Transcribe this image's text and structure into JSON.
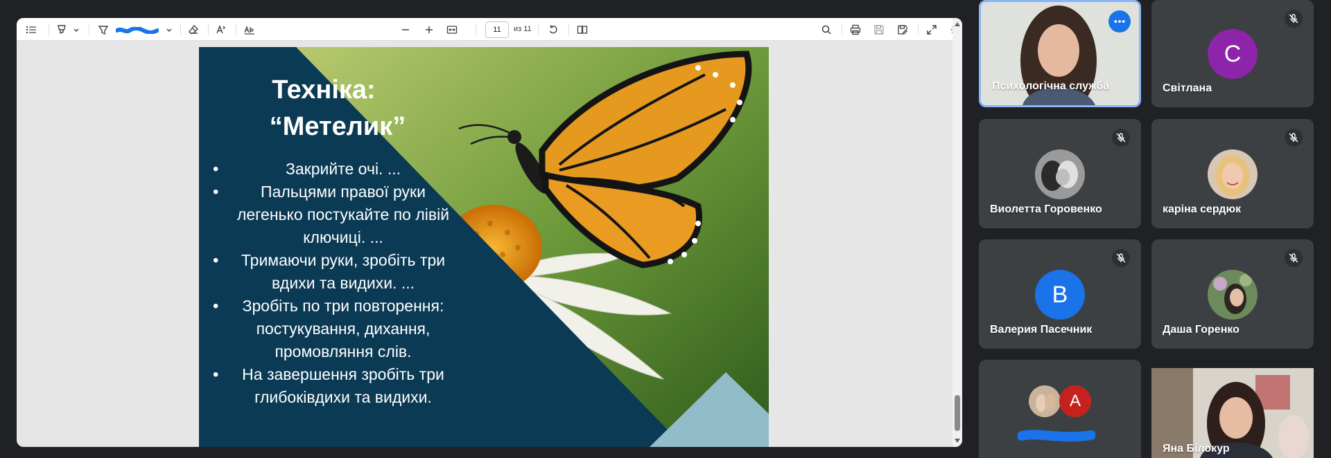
{
  "viewer": {
    "page_current": "11",
    "page_of": "из 11",
    "slide": {
      "title_line1": "Техніка:",
      "title_line2": "“Метелик”",
      "bullets": [
        "Закрийте очі. ...",
        "Пальцями правої руки легенько постукайте по лівій ключиці. ...",
        "Тримаючи руки, зробіть три вдихи та видихи. ...",
        "Зробіть по три повторення: постукування, дихання, промовляння слів.",
        "На завершення зробіть три глибоківдихи та видихи."
      ]
    },
    "icons": [
      "contents-icon",
      "highlighter-icon",
      "chevron-down-icon",
      "pen-icon",
      "color-scribble",
      "chevron-down-icon",
      "eraser-icon",
      "text-size-icon",
      "text-ab-icon",
      "zoom-out-icon",
      "zoom-in-icon",
      "fit-page-icon",
      "rotate-icon",
      "two-page-icon",
      "search-icon",
      "print-icon",
      "save-icon",
      "save-as-icon",
      "fullscreen-icon",
      "settings-icon"
    ]
  },
  "participants": [
    {
      "name": "Психологічна служба",
      "type": "video",
      "active_speaker": true
    },
    {
      "name": "Світлана",
      "type": "letter",
      "letter": "C",
      "color": "#8e24aa",
      "muted": true
    },
    {
      "name": "Виолетта Горовенко",
      "type": "photo",
      "muted": true
    },
    {
      "name": "каріна сердюк",
      "type": "photo",
      "muted": true
    },
    {
      "name": "Валерия Пасечник",
      "type": "letter",
      "letter": "B",
      "color": "#1a73e8",
      "muted": true
    },
    {
      "name": "Даша Горенко",
      "type": "photo",
      "muted": true
    },
    {
      "name": "",
      "type": "group",
      "letter": "A",
      "color": "#c5221f"
    },
    {
      "name": "Яна Білокур",
      "type": "video"
    }
  ],
  "colors": {
    "page_bg": "#202124",
    "tile_bg": "#3c4043",
    "active_border": "#8ab4f8",
    "slide_navy": "#0b3a55",
    "slide_light_triangle": "#93bccb"
  }
}
